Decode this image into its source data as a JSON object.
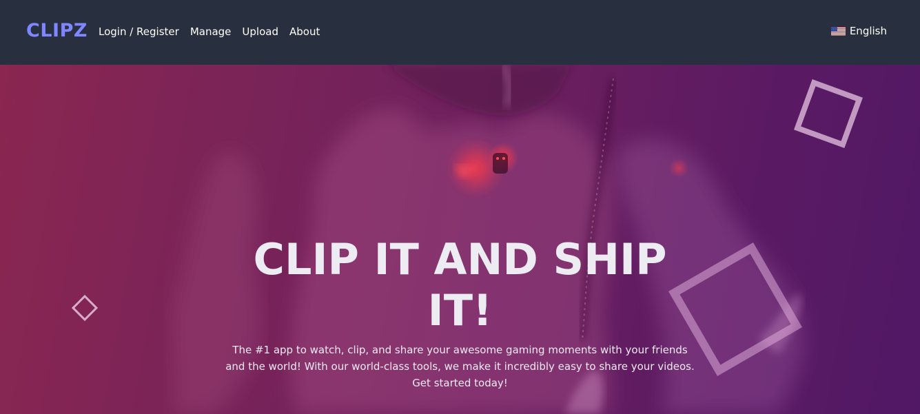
{
  "navbar": {
    "logo": "CLIPZ",
    "links": [
      {
        "label": "Login / Register"
      },
      {
        "label": "Manage"
      },
      {
        "label": "Upload"
      },
      {
        "label": "About"
      }
    ],
    "language": {
      "label": "English",
      "flag_icon": "us-flag-icon"
    }
  },
  "hero": {
    "title": "CLIP IT AND SHIP IT!",
    "description": "The #1 app to watch, clip, and share your awesome gaming moments with your friends and the world! With our world-class tools, we make it incredibly easy to share your videos. Get started today!",
    "background_icon": "gaming-scene-background",
    "decorations": [
      "diamond-outline-icon",
      "square-outline-icon",
      "square-outline-icon"
    ]
  },
  "colors": {
    "navbar_bg": "#28303f",
    "logo": "#7f86ff",
    "hero_gradient_start": "#8a2650",
    "hero_gradient_end": "#511865",
    "text": "#ffffff"
  }
}
